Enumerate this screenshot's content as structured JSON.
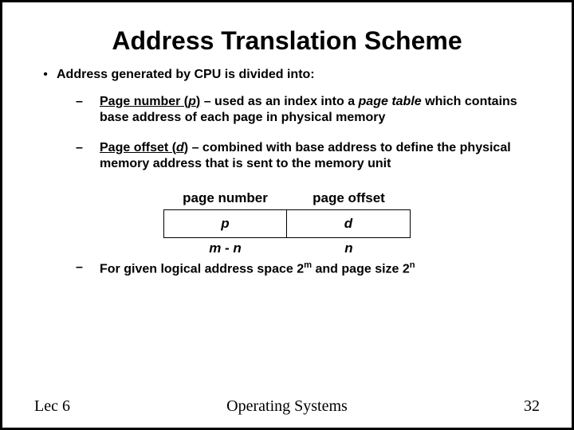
{
  "title": "Address Translation Scheme",
  "bullets": {
    "main": "Address generated by CPU is divided into:",
    "sub1_label": "Page number (",
    "sub1_var": "p",
    "sub1_close": ")",
    "sub1_rest": " – used as an index into a ",
    "sub1_em": "page table",
    "sub1_tail": " which contains base address of each page in physical memory",
    "sub2_label": "Page offset (",
    "sub2_var": "d",
    "sub2_close": ")",
    "sub2_rest": " – combined with base address to define the physical memory address that is sent to the memory unit",
    "sub3_pre": "For given logical address space 2",
    "sub3_sup1": "m",
    "sub3_mid": " and page size 2",
    "sub3_sup2": "n"
  },
  "diagram": {
    "h1": "page number",
    "h2": "page offset",
    "c1": "p",
    "c2": "d",
    "w1": "m - n",
    "w2": "n"
  },
  "footer": {
    "left": "Lec 6",
    "center": "Operating Systems",
    "right": "32"
  }
}
